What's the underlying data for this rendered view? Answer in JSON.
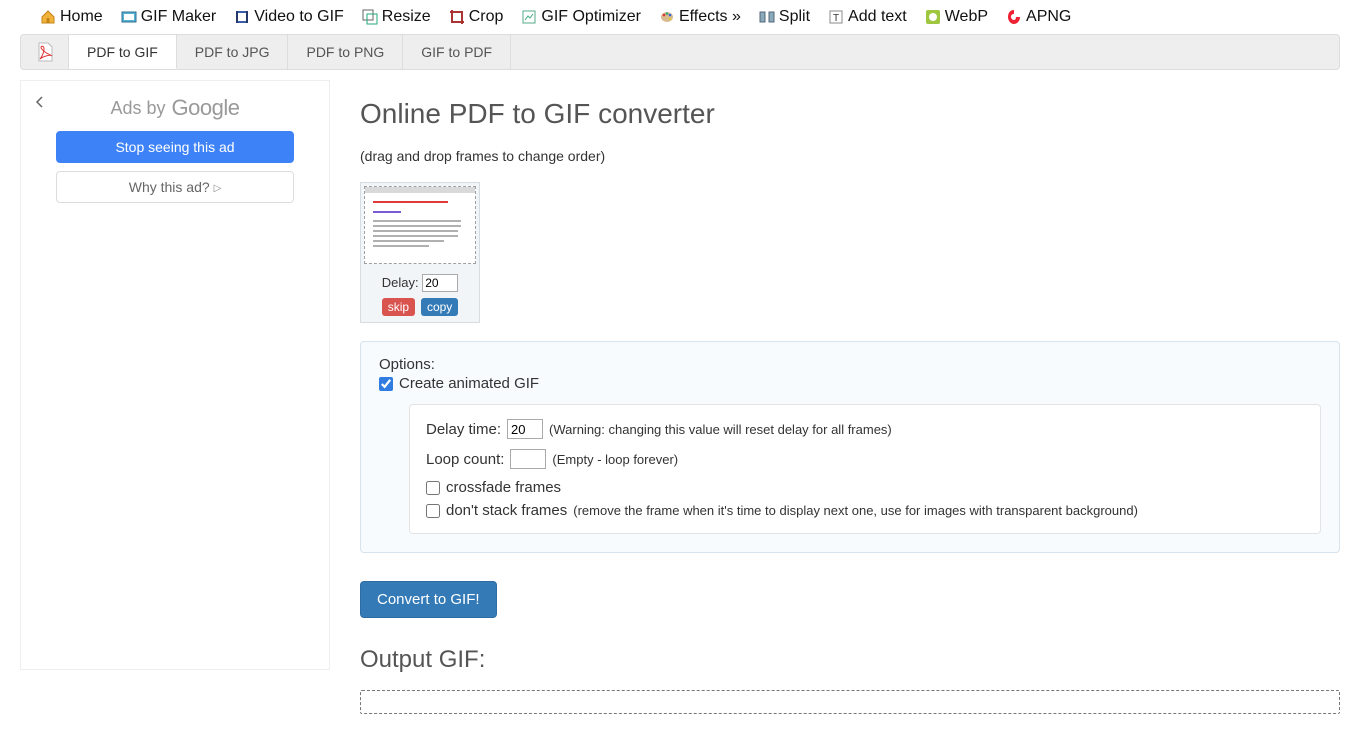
{
  "topnav": [
    {
      "label": "Home",
      "icon": "home"
    },
    {
      "label": "GIF Maker",
      "icon": "maker"
    },
    {
      "label": "Video to GIF",
      "icon": "video"
    },
    {
      "label": "Resize",
      "icon": "resize"
    },
    {
      "label": "Crop",
      "icon": "crop"
    },
    {
      "label": "GIF Optimizer",
      "icon": "optimize"
    },
    {
      "label": "Effects »",
      "icon": "effects"
    },
    {
      "label": "Split",
      "icon": "split"
    },
    {
      "label": "Add text",
      "icon": "addtext"
    },
    {
      "label": "WebP",
      "icon": "webp"
    },
    {
      "label": "APNG",
      "icon": "apng"
    }
  ],
  "tabs": [
    {
      "label": "PDF to GIF",
      "active": true
    },
    {
      "label": "PDF to JPG",
      "active": false
    },
    {
      "label": "PDF to PNG",
      "active": false
    },
    {
      "label": "GIF to PDF",
      "active": false
    }
  ],
  "ads": {
    "by_label": "Ads by",
    "brand": "Google",
    "stop_label": "Stop seeing this ad",
    "why_label": "Why this ad?"
  },
  "page": {
    "title": "Online PDF to GIF converter",
    "subnote": "(drag and drop frames to change order)"
  },
  "frame": {
    "delay_label": "Delay:",
    "delay_value": "20",
    "skip_label": "skip",
    "copy_label": "copy"
  },
  "options": {
    "heading": "Options:",
    "create_animated_label": "Create animated GIF",
    "create_animated_checked": true,
    "delay_time_label": "Delay time:",
    "delay_time_value": "20",
    "delay_warning": "(Warning: changing this value will reset delay for all frames)",
    "loop_label": "Loop count:",
    "loop_value": "",
    "loop_hint": "(Empty - loop forever)",
    "crossfade_label": "crossfade frames",
    "crossfade_checked": false,
    "dontstack_label": "don't stack frames",
    "dontstack_hint": "(remove the frame when it's time to display next one, use for images with transparent background)",
    "dontstack_checked": false
  },
  "actions": {
    "convert_label": "Convert to GIF!"
  },
  "output": {
    "heading": "Output GIF:"
  }
}
